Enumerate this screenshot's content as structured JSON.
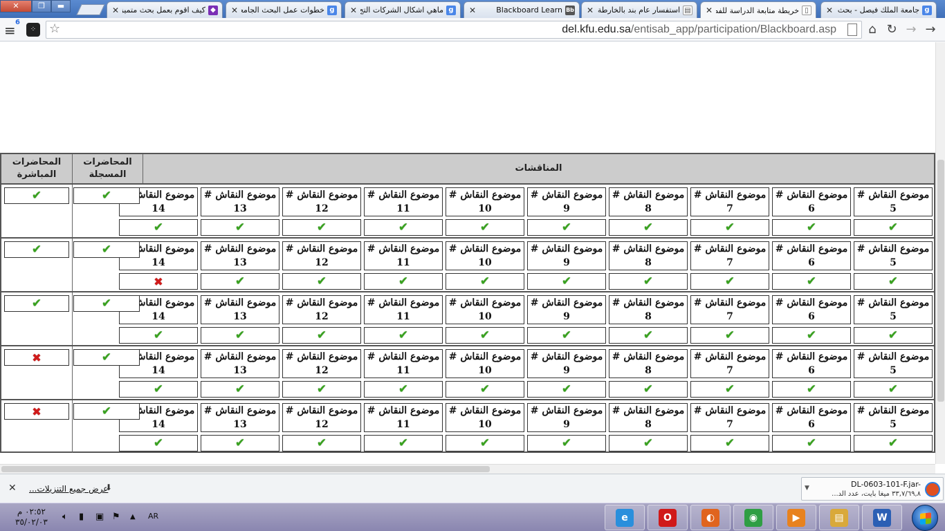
{
  "browser": {
    "tabs": [
      {
        "title": "جامعة الملك فيصل - بحث ع",
        "icon": "google-icon",
        "active": false
      },
      {
        "title": "خريطة متابعة الدراسة للفص",
        "icon": "document-icon",
        "active": true
      },
      {
        "title": "استفسار عام بند بالخارطة",
        "icon": "page-icon",
        "active": false
      },
      {
        "title": "Blackboard Learn",
        "icon": "blackboard-icon",
        "active": false
      },
      {
        "title": "ماهي اشكال الشركات التج",
        "icon": "google-icon",
        "active": false
      },
      {
        "title": "خطوات عمل البحث الجامعي",
        "icon": "google-icon",
        "active": false
      },
      {
        "title": "كيف اقوم بعمل بحث متميز",
        "icon": "site-icon",
        "active": false
      }
    ],
    "url": {
      "host": "del.kfu.edu.sa",
      "path": "/entisab_app/participation/Blackboard.asp"
    },
    "menu_badge": "6",
    "colors": {
      "tabstrip": "#4a7cc4",
      "check": "#38a21e",
      "cross": "#d11a1a",
      "header_bg": "#cccccc"
    }
  },
  "participation": {
    "headers": {
      "discussions": "المناقشات",
      "recorded": "المحاضرات\nالمسجلة",
      "live": "المحاضرات\nالمباشرة"
    },
    "rows": [
      {
        "topics": [
          {
            "label": "موضوع النقاش #\n5",
            "status": "check"
          },
          {
            "label": "موضوع النقاش #\n6",
            "status": "check"
          },
          {
            "label": "موضوع النقاش #\n7",
            "status": "check"
          },
          {
            "label": "موضوع النقاش #\n8",
            "status": "check"
          },
          {
            "label": "موضوع النقاش #\n9",
            "status": "check"
          },
          {
            "label": "موضوع النقاش #\n10",
            "status": "check"
          },
          {
            "label": "موضوع النقاش #\n11",
            "status": "check"
          },
          {
            "label": "موضوع النقاش #\n12",
            "status": "check"
          },
          {
            "label": "موضوع النقاش # 13",
            "status": "check"
          },
          {
            "label": "موضوع النقاش # 14",
            "status": "check"
          }
        ],
        "recorded": "check",
        "live": "check"
      },
      {
        "topics": [
          {
            "label": "موضوع النقاش #\n5",
            "status": "check"
          },
          {
            "label": "موضوع النقاش #\n6",
            "status": "check"
          },
          {
            "label": "موضوع النقاش #\n7",
            "status": "check"
          },
          {
            "label": "موضوع النقاش #\n8",
            "status": "check"
          },
          {
            "label": "موضوع النقاش #\n9",
            "status": "check"
          },
          {
            "label": "موضوع النقاش #\n10",
            "status": "check"
          },
          {
            "label": "موضوع النقاش #\n11",
            "status": "check"
          },
          {
            "label": "موضوع النقاش #\n12",
            "status": "check"
          },
          {
            "label": "موضوع النقاش # 13",
            "status": "check"
          },
          {
            "label": "موضوع النقاش # 14",
            "status": "cross"
          }
        ],
        "recorded": "check",
        "live": "check"
      },
      {
        "topics": [
          {
            "label": "موضوع النقاش #\n5",
            "status": "check"
          },
          {
            "label": "موضوع النقاش #\n6",
            "status": "check"
          },
          {
            "label": "موضوع النقاش #\n7",
            "status": "check"
          },
          {
            "label": "موضوع النقاش #\n8",
            "status": "check"
          },
          {
            "label": "موضوع النقاش #\n9",
            "status": "check"
          },
          {
            "label": "موضوع النقاش #\n10",
            "status": "check"
          },
          {
            "label": "موضوع النقاش #\n11",
            "status": "check"
          },
          {
            "label": "موضوع النقاش #\n12",
            "status": "check"
          },
          {
            "label": "موضوع النقاش # 13",
            "status": "check"
          },
          {
            "label": "موضوع النقاش # 14",
            "status": "check"
          }
        ],
        "recorded": "check",
        "live": "check"
      },
      {
        "topics": [
          {
            "label": "موضوع النقاش #\n5",
            "status": "check"
          },
          {
            "label": "موضوع النقاش #\n6",
            "status": "check"
          },
          {
            "label": "موضوع النقاش #\n7",
            "status": "check"
          },
          {
            "label": "موضوع النقاش #\n8",
            "status": "check"
          },
          {
            "label": "موضوع النقاش #\n9",
            "status": "check"
          },
          {
            "label": "موضوع النقاش #\n10",
            "status": "check"
          },
          {
            "label": "موضوع النقاش #\n11",
            "status": "check"
          },
          {
            "label": "موضوع النقاش #\n12",
            "status": "check"
          },
          {
            "label": "موضوع النقاش # 13",
            "status": "check"
          },
          {
            "label": "موضوع النقاش # 14",
            "status": "check"
          }
        ],
        "recorded": "check",
        "live": "cross"
      },
      {
        "topics": [
          {
            "label": "موضوع النقاش #\n5",
            "status": "check"
          },
          {
            "label": "موضوع النقاش #\n6",
            "status": "check"
          },
          {
            "label": "موضوع النقاش #\n7",
            "status": "check"
          },
          {
            "label": "موضوع النقاش #\n8",
            "status": "check"
          },
          {
            "label": "موضوع النقاش #\n9",
            "status": "check"
          },
          {
            "label": "موضوع النقاش #\n10",
            "status": "check"
          },
          {
            "label": "موضوع النقاش #\n11",
            "status": "check"
          },
          {
            "label": "موضوع النقاش #\n12",
            "status": "check"
          },
          {
            "label": "موضوع النقاش # 13",
            "status": "check"
          },
          {
            "label": "موضوع النقاش # 14",
            "status": "check"
          }
        ],
        "recorded": "check",
        "live": "cross"
      }
    ]
  },
  "downloads": {
    "file_name": "DL-0603-101-F.jar-",
    "file_status": "٣٣,٧/٦٩,٨ ميغا بايت، عدد الد...",
    "show_all": "عرض جميع التنزيلات..."
  },
  "taskbar": {
    "clock_time": "٠٢:٥٢ م",
    "clock_date": "٣٥/٠٢/٠٣",
    "language": "AR",
    "apps": [
      {
        "name": "word",
        "glyph": "W",
        "color": "#2b5fb4"
      },
      {
        "name": "explorer",
        "glyph": "▤",
        "color": "#d9a93a"
      },
      {
        "name": "media-player",
        "glyph": "▶",
        "color": "#e8821e"
      },
      {
        "name": "chrome",
        "glyph": "◉",
        "color": "#2f9e44"
      },
      {
        "name": "firefox",
        "glyph": "◐",
        "color": "#e0641e"
      },
      {
        "name": "opera",
        "glyph": "O",
        "color": "#d01919"
      },
      {
        "name": "internet-explorer",
        "glyph": "e",
        "color": "#2a8fdc"
      }
    ]
  }
}
